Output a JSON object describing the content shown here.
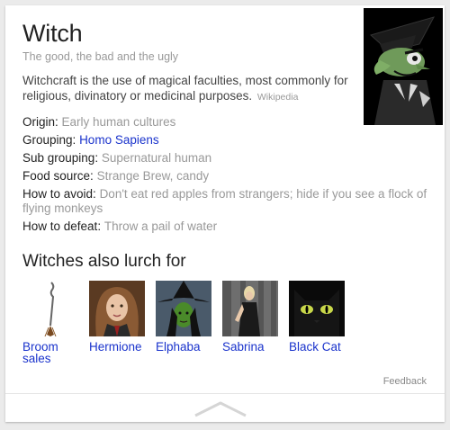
{
  "panel": {
    "title": "Witch",
    "subtitle": "The good, the bad and the ugly",
    "description": "Witchcraft is the use of magical faculties, most commonly for religious, divinatory or medicinal purposes.",
    "description_source": "Wikipedia",
    "hero_image": "witch-cartoon-image"
  },
  "facts": [
    {
      "label": "Origin",
      "value": "Early human cultures",
      "link": false
    },
    {
      "label": "Grouping",
      "value": "Homo Sapiens",
      "link": true
    },
    {
      "label": "Sub grouping",
      "value": "Supernatural human",
      "link": false
    },
    {
      "label": "Food source",
      "value": "Strange Brew, candy",
      "link": false
    },
    {
      "label": "How to avoid",
      "value": "Don't eat red apples from strangers; hide if you see a flock of flying monkeys",
      "link": false
    },
    {
      "label": "How to defeat",
      "value": "Throw a pail of water",
      "link": false
    }
  ],
  "related": {
    "heading": "Witches also lurch for",
    "items": [
      {
        "label": "Broom sales",
        "image": "broom-image"
      },
      {
        "label": "Hermione",
        "image": "hermione-image"
      },
      {
        "label": "Elphaba",
        "image": "elphaba-image"
      },
      {
        "label": "Sabrina",
        "image": "sabrina-image"
      },
      {
        "label": "Black Cat",
        "image": "black-cat-image"
      }
    ]
  },
  "footer": {
    "feedback": "Feedback",
    "collapse_icon": "chevron-up-icon"
  },
  "colors": {
    "link": "#1a33cc",
    "muted": "#999999",
    "text": "#222222",
    "background": "#ebebeb",
    "card": "#ffffff"
  }
}
